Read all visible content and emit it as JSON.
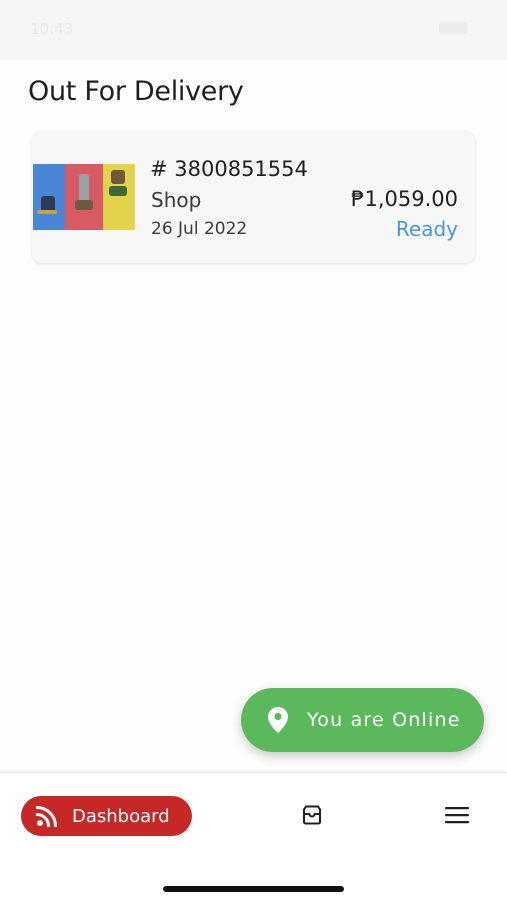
{
  "status_bar": {
    "time": "10:43"
  },
  "page": {
    "title": "Out For Delivery"
  },
  "orders": [
    {
      "number": "# 3800851554",
      "store": "Shop",
      "date": "26 Jul 2022",
      "amount": "₱1,059.00",
      "status": "Ready",
      "thumbnail_icon": "product-collage-image"
    }
  ],
  "online_toggle": {
    "label": "You are Online",
    "icon": "location-pin-icon",
    "color": "#5cb85c"
  },
  "bottom_nav": {
    "items": [
      {
        "label": "Dashboard",
        "icon": "rss-feed-icon",
        "active": true
      },
      {
        "label": "",
        "icon": "inbox-icon",
        "active": false
      },
      {
        "label": "",
        "icon": "hamburger-menu-icon",
        "active": false
      }
    ],
    "active_color": "#c62828"
  },
  "colors": {
    "status_ready": "#4a95d6",
    "accent_red": "#c62828",
    "online_green": "#5cb85c"
  }
}
